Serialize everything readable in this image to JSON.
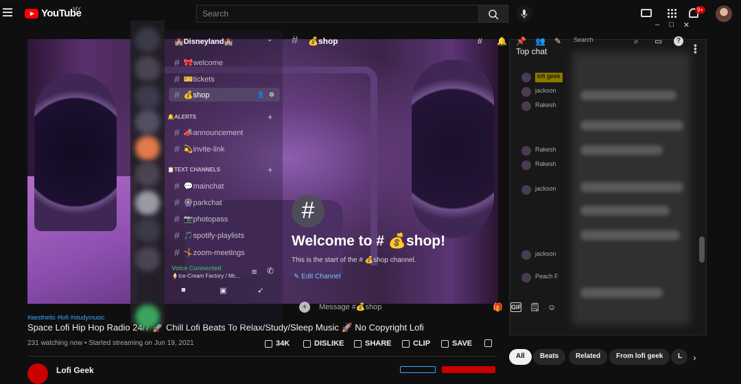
{
  "youtube": {
    "logo_text": "YouTube",
    "country_code": "MY",
    "search_placeholder": "Search",
    "notifications_badge": "9+"
  },
  "video": {
    "hashtags": "#aesthetic #lofi #studymusic",
    "title": "Space Lofi Hip Hop Radio 24/7 🚀 Chill Lofi Beats To Relax/Study/Sleep Music 🚀 No Copyright Lofi",
    "info": "231 watching now • Started streaming on Jun 19, 2021",
    "likes": "34K",
    "dislike_label": "DISLIKE",
    "share_label": "SHARE",
    "clip_label": "CLIP",
    "save_label": "SAVE",
    "channel_name": "Lofi Geek"
  },
  "live_chat": {
    "header": "Top chat",
    "rows": [
      {
        "name": "lofi geek"
      },
      {
        "name": "jackson"
      },
      {
        "name": "Rakesh"
      },
      {
        "name": "Rakesh"
      },
      {
        "name": "Rakesh"
      },
      {
        "name": "jackson"
      },
      {
        "name": "jackson"
      },
      {
        "name": "Peach F"
      }
    ]
  },
  "chips": [
    "All",
    "Beats",
    "Related",
    "From lofi geek",
    "L"
  ],
  "discord": {
    "server_name": "🏰Disneyland🏰",
    "channels": [
      {
        "label": "🎀welcome"
      },
      {
        "label": "🎫tickets"
      },
      {
        "label": "💰shop"
      }
    ],
    "categories": {
      "alerts": "🔔ALERTS",
      "text": "📋TEXT CHANNELS"
    },
    "alert_channels": [
      {
        "label": "📣announcement"
      },
      {
        "label": "💫invite-link"
      }
    ],
    "text_channels": [
      {
        "label": "💬mainchat"
      },
      {
        "label": "🎡parkchat"
      },
      {
        "label": "📷photopass"
      },
      {
        "label": "🎵spotify-playlists"
      },
      {
        "label": "🤸zoom-meetings"
      }
    ],
    "voice_status": "Voice Connected",
    "voice_channel": "🍦Ice-Cream Factory / Mc...",
    "header_channel": "💰shop",
    "search_placeholder": "Search",
    "welcome_title": "Welcome to # 💰shop!",
    "welcome_sub": "This is the start of the # 💰shop channel.",
    "edit_channel": "Edit Channel",
    "message_placeholder": "Message #💰shop",
    "gif_label": "GIF"
  },
  "colors": {
    "youtube_red": "#ff0000",
    "link_blue": "#3ea6ff",
    "voice_green": "#3ba55d"
  }
}
